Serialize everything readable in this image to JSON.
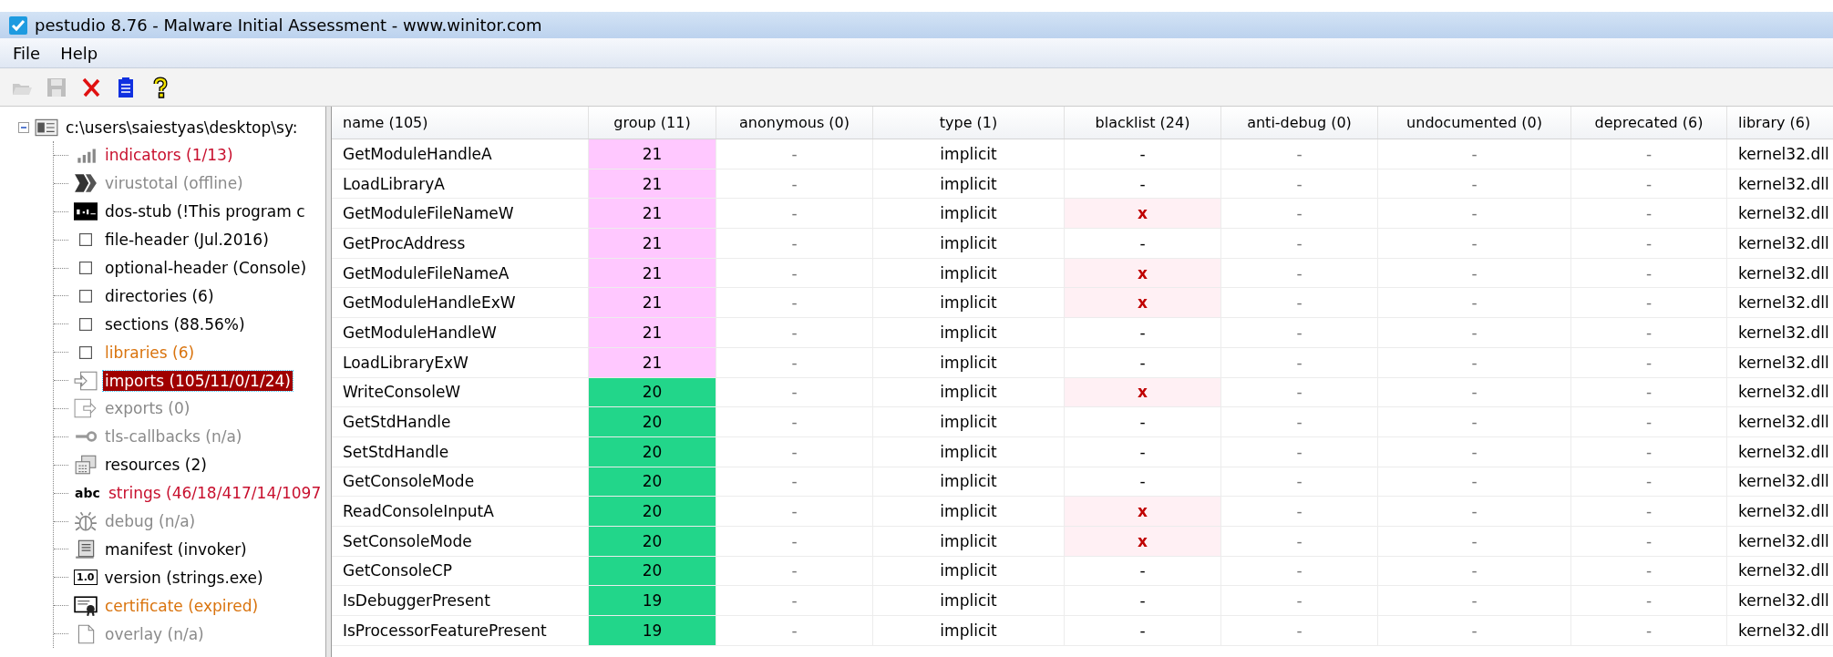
{
  "window": {
    "title": "pestudio 8.76 - Malware Initial Assessment - www.winitor.com"
  },
  "menu": [
    "File",
    "Help"
  ],
  "toolbar": [
    {
      "kind": "open",
      "disabled": true
    },
    {
      "kind": "save",
      "disabled": true
    },
    {
      "kind": "close",
      "disabled": false
    },
    {
      "kind": "clipboard",
      "disabled": false
    },
    {
      "kind": "help",
      "disabled": false
    }
  ],
  "tree": {
    "root": {
      "label": "c:\\users\\saiestyas\\desktop\\sy:",
      "expanded": true
    },
    "children": [
      {
        "label": "indicators (1/13)",
        "kind": "bars",
        "color": "#c8102e",
        "selected": false
      },
      {
        "label": "virustotal (offline)",
        "kind": "chevrons",
        "color": "#8a8a8a",
        "selected": false
      },
      {
        "label": "dos-stub (!This program c",
        "kind": "console",
        "color": "#000000",
        "selected": false
      },
      {
        "label": "file-header (Jul.2016)",
        "kind": "square",
        "color": "#000000",
        "selected": false
      },
      {
        "label": "optional-header (Console)",
        "kind": "square",
        "color": "#000000",
        "selected": false
      },
      {
        "label": "directories (6)",
        "kind": "square",
        "color": "#000000",
        "selected": false
      },
      {
        "label": "sections (88.56%)",
        "kind": "square",
        "color": "#000000",
        "selected": false
      },
      {
        "label": "libraries (6)",
        "kind": "square",
        "color": "#d9730d",
        "selected": false
      },
      {
        "label": "imports (105/11/0/1/24)",
        "kind": "import",
        "color": "#a00000",
        "selected": true
      },
      {
        "label": "exports (0)",
        "kind": "export",
        "color": "#8a8a8a",
        "selected": false
      },
      {
        "label": "tls-callbacks (n/a)",
        "kind": "key",
        "color": "#8a8a8a",
        "selected": false
      },
      {
        "label": "resources (2)",
        "kind": "resources",
        "color": "#000000",
        "selected": false
      },
      {
        "label": "strings (46/18/417/14/1097",
        "kind": "text",
        "icon_text": "abc",
        "color": "#c8102e",
        "selected": false
      },
      {
        "label": "debug (n/a)",
        "kind": "bug",
        "color": "#8a8a8a",
        "selected": false
      },
      {
        "label": "manifest (invoker)",
        "kind": "scroll",
        "color": "#000000",
        "selected": false
      },
      {
        "label": "version (strings.exe)",
        "kind": "boxtext",
        "icon_text": "1.0",
        "color": "#000000",
        "selected": false
      },
      {
        "label": "certificate (expired)",
        "kind": "certificate",
        "color": "#d9730d",
        "selected": false
      },
      {
        "label": "overlay (n/a)",
        "kind": "page",
        "color": "#8a8a8a",
        "selected": false
      }
    ]
  },
  "table": {
    "columns": [
      "name (105)",
      "group (11)",
      "anonymous (0)",
      "type (1)",
      "blacklist (24)",
      "anti-debug (0)",
      "undocumented (0)",
      "deprecated (6)",
      "library (6)"
    ],
    "rows": [
      {
        "cells": [
          "GetModuleHandleA",
          "21",
          "-",
          "implicit",
          "-",
          "-",
          "-",
          "-",
          "kernel32.dll"
        ],
        "color": "#ffc8ff",
        "flagged": false
      },
      {
        "cells": [
          "LoadLibraryA",
          "21",
          "-",
          "implicit",
          "-",
          "-",
          "-",
          "-",
          "kernel32.dll"
        ],
        "color": "#ffc8ff",
        "flagged": false
      },
      {
        "cells": [
          "GetModuleFileNameW",
          "21",
          "-",
          "implicit",
          "x",
          "-",
          "-",
          "-",
          "kernel32.dll"
        ],
        "color": "#ffc8ff",
        "flagged": true
      },
      {
        "cells": [
          "GetProcAddress",
          "21",
          "-",
          "implicit",
          "-",
          "-",
          "-",
          "-",
          "kernel32.dll"
        ],
        "color": "#ffc8ff",
        "flagged": false
      },
      {
        "cells": [
          "GetModuleFileNameA",
          "21",
          "-",
          "implicit",
          "x",
          "-",
          "-",
          "-",
          "kernel32.dll"
        ],
        "color": "#ffc8ff",
        "flagged": true
      },
      {
        "cells": [
          "GetModuleHandleExW",
          "21",
          "-",
          "implicit",
          "x",
          "-",
          "-",
          "-",
          "kernel32.dll"
        ],
        "color": "#ffc8ff",
        "flagged": true
      },
      {
        "cells": [
          "GetModuleHandleW",
          "21",
          "-",
          "implicit",
          "-",
          "-",
          "-",
          "-",
          "kernel32.dll"
        ],
        "color": "#ffc8ff",
        "flagged": false
      },
      {
        "cells": [
          "LoadLibraryExW",
          "21",
          "-",
          "implicit",
          "-",
          "-",
          "-",
          "-",
          "kernel32.dll"
        ],
        "color": "#ffc8ff",
        "flagged": false
      },
      {
        "cells": [
          "WriteConsoleW",
          "20",
          "-",
          "implicit",
          "x",
          "-",
          "-",
          "-",
          "kernel32.dll"
        ],
        "color": "#22d68a",
        "flagged": true
      },
      {
        "cells": [
          "GetStdHandle",
          "20",
          "-",
          "implicit",
          "-",
          "-",
          "-",
          "-",
          "kernel32.dll"
        ],
        "color": "#22d68a",
        "flagged": false
      },
      {
        "cells": [
          "SetStdHandle",
          "20",
          "-",
          "implicit",
          "-",
          "-",
          "-",
          "-",
          "kernel32.dll"
        ],
        "color": "#22d68a",
        "flagged": false
      },
      {
        "cells": [
          "GetConsoleMode",
          "20",
          "-",
          "implicit",
          "-",
          "-",
          "-",
          "-",
          "kernel32.dll"
        ],
        "color": "#22d68a",
        "flagged": false
      },
      {
        "cells": [
          "ReadConsoleInputA",
          "20",
          "-",
          "implicit",
          "x",
          "-",
          "-",
          "-",
          "kernel32.dll"
        ],
        "color": "#22d68a",
        "flagged": true
      },
      {
        "cells": [
          "SetConsoleMode",
          "20",
          "-",
          "implicit",
          "x",
          "-",
          "-",
          "-",
          "kernel32.dll"
        ],
        "color": "#22d68a",
        "flagged": true
      },
      {
        "cells": [
          "GetConsoleCP",
          "20",
          "-",
          "implicit",
          "-",
          "-",
          "-",
          "-",
          "kernel32.dll"
        ],
        "color": "#22d68a",
        "flagged": false
      },
      {
        "cells": [
          "IsDebuggerPresent",
          "19",
          "-",
          "implicit",
          "-",
          "-",
          "-",
          "-",
          "kernel32.dll"
        ],
        "color": "#22d68a",
        "flagged": false
      },
      {
        "cells": [
          "IsProcessorFeaturePresent",
          "19",
          "-",
          "implicit",
          "-",
          "-",
          "-",
          "-",
          "kernel32.dll"
        ],
        "color": "#22d68a",
        "flagged": false
      }
    ]
  }
}
